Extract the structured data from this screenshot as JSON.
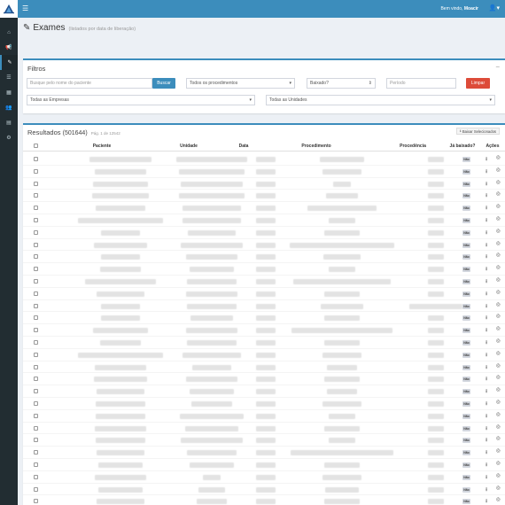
{
  "topbar": {
    "hamburger_icon": "bars-icon",
    "welcome_prefix": "Bem vindo, ",
    "user_name": "Moacir",
    "user_icon": "user-icon",
    "brand_color": "#3c8dbc"
  },
  "sidebar": {
    "items": [
      {
        "icon": "home-icon",
        "glyph": "⌂"
      },
      {
        "icon": "megaphone-icon",
        "glyph": "📢"
      },
      {
        "icon": "edit-icon",
        "glyph": "✎"
      },
      {
        "icon": "list-icon",
        "glyph": "☰"
      },
      {
        "icon": "calendar-icon",
        "glyph": "▦"
      },
      {
        "icon": "users-icon",
        "glyph": "👥"
      },
      {
        "icon": "file-icon",
        "glyph": "▤"
      },
      {
        "icon": "cogs-icon",
        "glyph": "⚙"
      }
    ],
    "active_index": 2
  },
  "header": {
    "title": "Exames",
    "subtitle": "(listados por data de liberação)"
  },
  "filters": {
    "title": "Filtros",
    "collapse_label": "−",
    "search_placeholder": "Busque pelo nome do paciente",
    "search_button": "Buscar",
    "procedures_select": "Todos os procedimentos",
    "baixado_select": "Baixado?",
    "period_placeholder": "Período",
    "clear_button": "Limpar",
    "companies_select": "Todas as Empresas",
    "units_select": "Todas as Unidades"
  },
  "results": {
    "title": "Resultados",
    "count": "(501644)",
    "page_info": "Pág. 1 de 12542",
    "download_selected": "Baixar Selecionados",
    "columns": {
      "paciente": "Paciente",
      "unidade": "Unidade",
      "data": "Data",
      "procedimento": "Procedimento",
      "procedencia": "Procedência",
      "ja_baixado": "Já baixado?",
      "acoes": "Ações"
    },
    "badge_label": "Não",
    "row_count": 30
  }
}
